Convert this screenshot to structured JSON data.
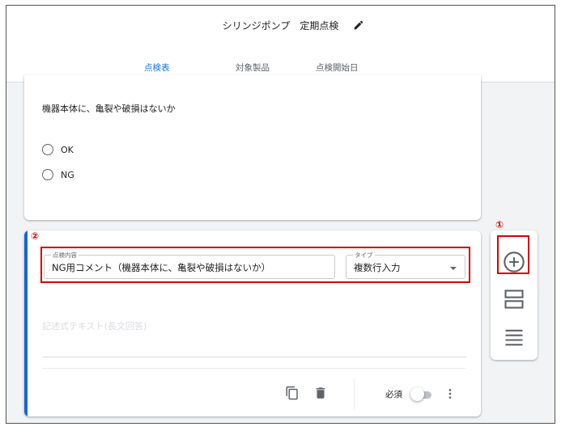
{
  "header": {
    "title": "シリンジポンプ　定期点検",
    "tabs": [
      {
        "label": "点検表",
        "active": true
      },
      {
        "label": "対象製品",
        "active": false
      },
      {
        "label": "点検開始日",
        "active": false
      }
    ]
  },
  "question_card": {
    "question": "機器本体に、亀裂や破損はないか",
    "options": [
      "OK",
      "NG"
    ]
  },
  "active_card": {
    "content_label": "点検内容",
    "content_value": "NG用コメント（機器本体に、亀裂や破損はないか）",
    "type_label": "タイプ",
    "type_value": "複数行入力",
    "answer_placeholder": "記述式テキスト(長文回答)",
    "required_label": "必須"
  },
  "annotations": {
    "marker_1": "①",
    "marker_2": "②"
  },
  "colors": {
    "accent": "#1a73e8",
    "highlight": "#d50000"
  }
}
